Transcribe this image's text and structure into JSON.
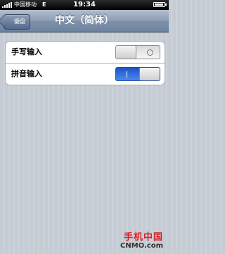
{
  "status_bar": {
    "carrier": "中国移动",
    "network": "E",
    "time": "19:34",
    "battery_level": 0.9
  },
  "nav": {
    "back_label": "键盘",
    "title": "中文（简体）"
  },
  "settings": [
    {
      "label": "手写输入",
      "state": "off"
    },
    {
      "label": "拼音输入",
      "state": "on"
    }
  ],
  "watermark": {
    "name": "手机中国",
    "domain": "CNMO.com"
  },
  "colors": {
    "switch_on": "#2f6de0",
    "nav_bar": "#8d9db3",
    "watermark_red": "#d8202a"
  },
  "icons": [
    "signal-icon",
    "battery-icon",
    "back-arrow-icon"
  ]
}
